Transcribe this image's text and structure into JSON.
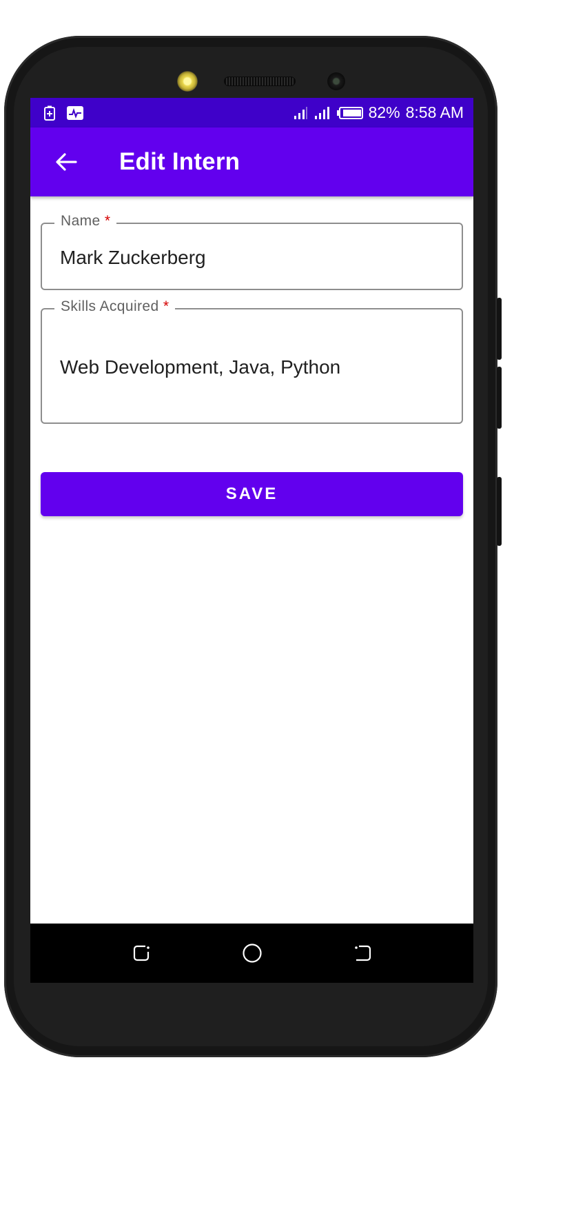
{
  "status_bar": {
    "battery_percent": "82%",
    "time": "8:58 AM",
    "icons": [
      "battery-saver-icon",
      "activity-monitor-icon",
      "signal-icon",
      "signal-icon",
      "battery-icon"
    ]
  },
  "app_bar": {
    "title": "Edit Intern",
    "back_icon": "arrow-back-icon"
  },
  "form": {
    "name": {
      "label": "Name",
      "required_mark": "*",
      "value": "Mark Zuckerberg"
    },
    "skills": {
      "label": "Skills Acquired",
      "required_mark": "*",
      "value": "Web Development, Java, Python"
    },
    "save_label": "SAVE"
  },
  "nav_bar": {
    "icons": [
      "recent-apps-icon",
      "home-icon",
      "back-icon"
    ]
  },
  "colors": {
    "primary": "#6200ee",
    "status_bar": "#3f01c9",
    "required": "#d50000"
  }
}
